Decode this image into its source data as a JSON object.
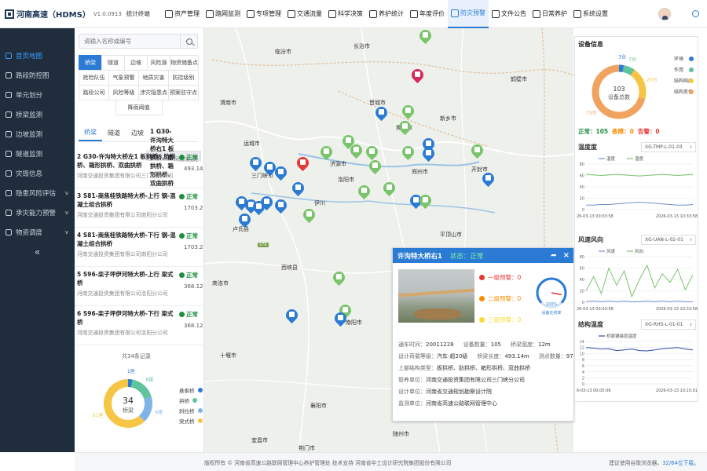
{
  "header": {
    "title": "河南高速（HDMS）",
    "version": "V1.0.0913",
    "terminal": "统计终端",
    "nav": [
      {
        "label": "资产管理",
        "active": false
      },
      {
        "label": "路网监测",
        "active": false
      },
      {
        "label": "专项管理",
        "active": false
      },
      {
        "label": "交通流量",
        "active": false
      },
      {
        "label": "科学决策",
        "active": false
      },
      {
        "label": "养护统计",
        "active": false
      },
      {
        "label": "年度评价",
        "active": false
      },
      {
        "label": "防灾预警",
        "active": true
      },
      {
        "label": "文件公告",
        "active": false
      },
      {
        "label": "日常养护",
        "active": false
      },
      {
        "label": "系统设置",
        "active": false
      }
    ]
  },
  "sidebar": {
    "items": [
      {
        "label": "首页地图",
        "active": true,
        "arrow": ""
      },
      {
        "label": "路段防控图",
        "active": false,
        "arrow": ""
      },
      {
        "label": "单元划分",
        "active": false,
        "arrow": ""
      },
      {
        "label": "桥梁监测",
        "active": false,
        "arrow": ""
      },
      {
        "label": "边坡监测",
        "active": false,
        "arrow": ""
      },
      {
        "label": "隧道监测",
        "active": false,
        "arrow": ""
      },
      {
        "label": "灾毁信息",
        "active": false,
        "arrow": ""
      },
      {
        "label": "隐患风险评估",
        "active": false,
        "arrow": "v"
      },
      {
        "label": "承灾能力预警",
        "active": false,
        "arrow": "v"
      },
      {
        "label": "物资调度",
        "active": false,
        "arrow": "v"
      }
    ],
    "collapse": "«"
  },
  "panel": {
    "search_placeholder": "请输入名称或编号",
    "filter_rows": [
      [
        {
          "label": "桥梁",
          "on": true
        },
        {
          "label": "隧道",
          "on": false
        },
        {
          "label": "边坡",
          "on": false
        },
        {
          "label": "风险源",
          "on": false
        },
        {
          "label": "物资储备点",
          "on": false
        }
      ],
      [
        {
          "label": "抢险队伍",
          "on": false
        },
        {
          "label": "气象预警",
          "on": false
        },
        {
          "label": "地质灾害",
          "on": false
        },
        {
          "label": "防控级别",
          "on": false
        }
      ],
      [
        {
          "label": "路段公司",
          "on": false
        },
        {
          "label": "风险等级",
          "on": false
        },
        {
          "label": "涉灾隐患点",
          "on": false
        },
        {
          "label": "预案驻守点",
          "on": false
        }
      ],
      [
        {
          "label": "降雨阈值",
          "on": false
        }
      ]
    ],
    "subtabs": [
      {
        "label": "桥梁",
        "on": true
      },
      {
        "label": "隧道",
        "on": false
      },
      {
        "label": "边坡",
        "on": false
      }
    ],
    "bridges": [
      {
        "name": "1 G30-许沟特大桥右1 板拱桥、肋拱桥、箱形拱桥、双曲拱桥",
        "org": "河南交通投资集团有限公司三门峡分公司",
        "status": "正常",
        "length": "493.14m",
        "sel": true
      },
      {
        "name": "2 G30-许沟特大桥左1 板拱桥、肋拱桥、箱形拱桥、双曲拱桥",
        "org": "河南交通投资集团有限公司三门峡分公司",
        "status": "正常",
        "length": "493.14m",
        "sel": false
      },
      {
        "name": "3 S81-商焦桂铁路特大桥-上行 钢-混凝土组合拱桥",
        "org": "河南交通投资集团有限公司南阳分公司",
        "status": "正常",
        "length": "1703.2m",
        "sel": false
      },
      {
        "name": "4 S81-商焦桂铁路特大桥-下行 钢-混凝土组合拱桥",
        "org": "河南交通投资集团有限公司南阳分公司",
        "status": "正常",
        "length": "1703.2m",
        "sel": false
      },
      {
        "name": "5 S96-栾子坪伊河特大桥-上行 梁式桥",
        "org": "河南交通投资集团有限公司洛阳分公司",
        "status": "正常",
        "length": "368.12m",
        "sel": false
      },
      {
        "name": "6 S96-栾子坪伊河特大桥-下行 梁式桥",
        "org": "河南交通投资集团有限公司洛阳分公司",
        "status": "正常",
        "length": "368.12m",
        "sel": false
      }
    ],
    "donut": {
      "total_text": "共34条记录",
      "center_value": "34",
      "center_label": "桥梁",
      "segments": [
        {
          "label": "悬索桥",
          "value": 1,
          "color": "#2b7bd4",
          "tag": "1座"
        },
        {
          "label": "拱桥",
          "value": 6,
          "color": "#5fc39b",
          "tag": "6座"
        },
        {
          "label": "斜拉桥",
          "value": 6,
          "color": "#7fb3e8",
          "tag": "6座"
        },
        {
          "label": "梁式桥",
          "value": 21,
          "color": "#f6c544",
          "tag": "21座"
        }
      ]
    }
  },
  "map": {
    "cities": [
      {
        "name": "临汾市"
      },
      {
        "name": "长治市"
      },
      {
        "name": "晋城市"
      },
      {
        "name": "焦作市"
      },
      {
        "name": "新乡市"
      },
      {
        "name": "鹤壁市"
      },
      {
        "name": "运城市"
      },
      {
        "name": "济源市"
      },
      {
        "name": "三门峡市"
      },
      {
        "name": "洛阳市"
      },
      {
        "name": "郑州市"
      },
      {
        "name": "开封市"
      },
      {
        "name": "平顶山市"
      },
      {
        "name": "南阳市"
      },
      {
        "name": "十堰市"
      },
      {
        "name": "襄阳市"
      },
      {
        "name": "商洛市"
      },
      {
        "name": "宜昌市"
      },
      {
        "name": "荆门市"
      },
      {
        "name": "随州市"
      },
      {
        "name": "西峡县"
      },
      {
        "name": "渭南市"
      },
      {
        "name": "卢氏县"
      },
      {
        "name": "伊川"
      }
    ],
    "road_label": "S76"
  },
  "popup": {
    "title": "许沟特大桥右1",
    "status": "状态：正常",
    "share_icon": "➦",
    "close_icon": "×",
    "alarms": [
      {
        "label": "一级预警：",
        "value": "0",
        "color": "#e53935"
      },
      {
        "label": "二级预警：",
        "value": "0",
        "color": "#fb8c00"
      },
      {
        "label": "三级预警：",
        "value": "0",
        "color": "#fdd835"
      }
    ],
    "gauge_label": "设备在线率",
    "gauge_value": 100,
    "gauge_value_text": "100%",
    "info": [
      [
        {
          "k": "通车时间：",
          "v": "20011228"
        },
        {
          "k": "设备数量：",
          "v": "105"
        },
        {
          "k": "桥梁宽度：",
          "v": "12m"
        }
      ],
      [
        {
          "k": "设计荷载等级：",
          "v": "汽车-超20级"
        },
        {
          "k": "桥梁长度：",
          "v": "493.14m"
        },
        {
          "k": "测点数量：",
          "v": "97"
        }
      ],
      [
        {
          "k": "上部结构类型：",
          "v": "板拱桥、肋拱桥、箱形拱桥、双曲拱桥"
        }
      ],
      [
        {
          "k": "管养单位：",
          "v": "河南交通投资集团有限公司三门峡分公司"
        }
      ],
      [
        {
          "k": "设计单位：",
          "v": "河南省交通规划勘察设计院"
        }
      ],
      [
        {
          "k": "监测单位：",
          "v": "河南省高速公路联网管理中心"
        }
      ]
    ]
  },
  "right": {
    "device_title": "设备信息",
    "device_total": "103",
    "device_total_label": "设备总数",
    "device_segments": [
      {
        "label": "环境",
        "value": 3,
        "color": "#2b7bd4",
        "tag": "3台"
      },
      {
        "label": "作用",
        "value": 7,
        "color": "#5fc39b",
        "tag": "7台"
      },
      {
        "label": "结构响应",
        "value": 20,
        "color": "#f6c544",
        "tag": "20台"
      },
      {
        "label": "结构变化",
        "value": 73,
        "color": "#f0a35e",
        "tag": "73台"
      }
    ],
    "counts": [
      {
        "label": "正常：",
        "value": "105",
        "color": "#1e8e3e"
      },
      {
        "label": "故障：",
        "value": "0",
        "color": "#fb8c00"
      },
      {
        "label": "告警：",
        "value": "0",
        "color": "#e53935"
      }
    ],
    "charts": [
      {
        "title": "温度度",
        "select": "XG-TMP-L-01-03",
        "legend": [
          "温度",
          "湿度"
        ],
        "x_start": "26-03-13 00:03:58",
        "x_end": "2026-03-13 10:33:58",
        "y_ticks": [
          "80",
          "60",
          "40",
          "20",
          "0"
        ],
        "ylim": [
          0,
          80
        ],
        "series": [
          {
            "name": "温度",
            "color": "#6f8fd0",
            "values": [
              8,
              8,
              9,
              9,
              10,
              11,
              12,
              13,
              12,
              11,
              10,
              9,
              8,
              8,
              9
            ]
          },
          {
            "name": "湿度",
            "color": "#7ac46b",
            "values": [
              62,
              61,
              60,
              61,
              62,
              61,
              60,
              59,
              60,
              61,
              62,
              61,
              60,
              61,
              62
            ]
          }
        ]
      },
      {
        "title": "风速风向",
        "select": "XG-UAN-L-02-01",
        "legend": [
          "风速",
          "风向"
        ],
        "x_start": "26-03-13 00:03:58",
        "x_end": "2026-03-13 10:33:58",
        "y_ticks": [
          "80",
          "60",
          "40",
          "20",
          "0"
        ],
        "ylim": [
          0,
          80
        ],
        "series": [
          {
            "name": "风速",
            "color": "#6f8fd0",
            "values": [
              1,
              2,
              1,
              2,
              1,
              2,
              1,
              1,
              2,
              1,
              2,
              1,
              2,
              1,
              1
            ]
          },
          {
            "name": "风向",
            "color": "#7ac46b",
            "values": [
              20,
              45,
              15,
              60,
              30,
              55,
              10,
              40,
              65,
              25,
              50,
              35,
              58,
              22,
              48
            ]
          }
        ]
      },
      {
        "title": "结构温度",
        "select": "XG-RHS-L-01-01",
        "legend": [
          "桥面铺装层温度"
        ],
        "x_start": "6-03-13 00:05:06",
        "x_end": "2026-03-13 10:15:01",
        "y_ticks": [
          "14",
          "12",
          "10",
          "8",
          "6",
          "4",
          "2",
          "0"
        ],
        "ylim": [
          0,
          14
        ],
        "series": [
          {
            "name": "桥面铺装层温度",
            "color": "#2b4aa8",
            "values": [
              12,
              11.8,
              11.5,
              11.6,
              11,
              11.2,
              11.5,
              11,
              10.9,
              11.2,
              11.6,
              11.8,
              12,
              11.5,
              11.2
            ]
          }
        ]
      }
    ]
  },
  "footer": {
    "copyright": "版权所有 © 河南省高速公路联网管理中心养护管理处 技术支持 河南省中工设计研究院集团股份有限公司",
    "hint": "建议使用谷歌浏览器，",
    "download": "32/64位下载。"
  }
}
